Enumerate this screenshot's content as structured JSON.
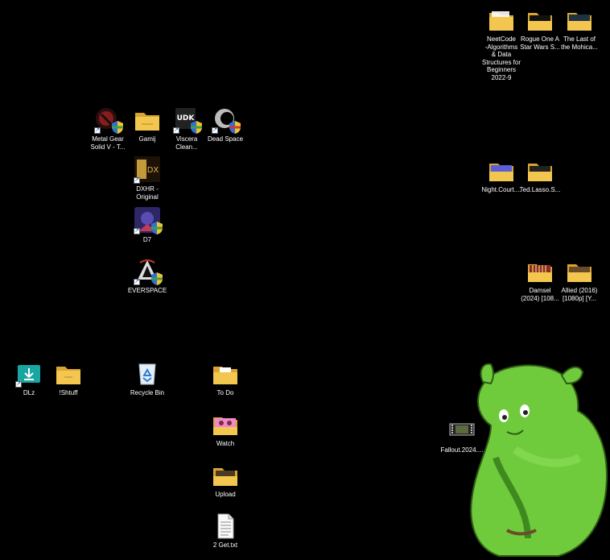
{
  "desktop": {
    "icons": [
      {
        "id": "neetcode",
        "label": "NeetCode\n-Algorithms\n& Data\nStructures for\nBeginners\n2022-9",
        "type": "folder"
      },
      {
        "id": "rogue-one",
        "label": "Rogue One A\nStar Wars S...",
        "type": "folder"
      },
      {
        "id": "last-mohicans",
        "label": "The Last of\nthe Mohica...",
        "type": "folder"
      },
      {
        "id": "metal-gear",
        "label": "Metal Gear\nSolid V - T...",
        "type": "game-shortcut"
      },
      {
        "id": "gamij",
        "label": "Gamij",
        "type": "folder"
      },
      {
        "id": "viscera",
        "label": "Viscera\nClean...",
        "type": "game-shortcut"
      },
      {
        "id": "dead-space",
        "label": "Dead Space",
        "type": "game-shortcut"
      },
      {
        "id": "dxhr",
        "label": "DXHR -\nOriginal",
        "type": "game-shortcut"
      },
      {
        "id": "d7",
        "label": "D7",
        "type": "game-shortcut"
      },
      {
        "id": "everspace",
        "label": "EVERSPACE",
        "type": "game-shortcut"
      },
      {
        "id": "night-court",
        "label": "Night.Court....",
        "type": "folder"
      },
      {
        "id": "ted-lasso",
        "label": "Ted.Lasso.S...",
        "type": "folder"
      },
      {
        "id": "damsel",
        "label": "Damsel\n(2024) [108...",
        "type": "folder"
      },
      {
        "id": "allied",
        "label": "Allied (2016)\n[1080p] [Y...",
        "type": "folder"
      },
      {
        "id": "dlz",
        "label": "DLz",
        "type": "download-shortcut"
      },
      {
        "id": "shtuff",
        "label": "!Shtuff",
        "type": "folder"
      },
      {
        "id": "recycle-bin",
        "label": "Recycle Bin",
        "type": "recycle-bin"
      },
      {
        "id": "todo",
        "label": "To Do",
        "type": "folder"
      },
      {
        "id": "watch",
        "label": "Watch",
        "type": "folder"
      },
      {
        "id": "upload",
        "label": "Upload",
        "type": "folder"
      },
      {
        "id": "get-txt",
        "label": "2 Get.txt",
        "type": "text-file"
      },
      {
        "id": "fallout",
        "label": "Fallout.2024....",
        "type": "video-file"
      }
    ]
  },
  "colors": {
    "background": "#000000",
    "folder": "#f3c74f",
    "folder_dark": "#d9a430",
    "wallpaper_green": "#6fcb3c"
  }
}
